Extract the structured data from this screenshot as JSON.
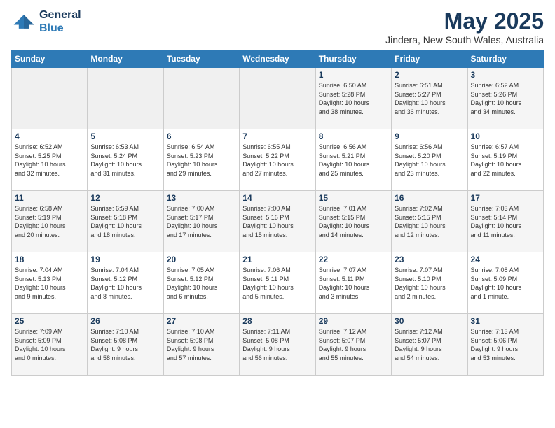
{
  "header": {
    "logo_line1": "General",
    "logo_line2": "Blue",
    "month": "May 2025",
    "location": "Jindera, New South Wales, Australia"
  },
  "days_of_week": [
    "Sunday",
    "Monday",
    "Tuesday",
    "Wednesday",
    "Thursday",
    "Friday",
    "Saturday"
  ],
  "weeks": [
    [
      {
        "day": "",
        "info": ""
      },
      {
        "day": "",
        "info": ""
      },
      {
        "day": "",
        "info": ""
      },
      {
        "day": "",
        "info": ""
      },
      {
        "day": "1",
        "info": "Sunrise: 6:50 AM\nSunset: 5:28 PM\nDaylight: 10 hours\nand 38 minutes."
      },
      {
        "day": "2",
        "info": "Sunrise: 6:51 AM\nSunset: 5:27 PM\nDaylight: 10 hours\nand 36 minutes."
      },
      {
        "day": "3",
        "info": "Sunrise: 6:52 AM\nSunset: 5:26 PM\nDaylight: 10 hours\nand 34 minutes."
      }
    ],
    [
      {
        "day": "4",
        "info": "Sunrise: 6:52 AM\nSunset: 5:25 PM\nDaylight: 10 hours\nand 32 minutes."
      },
      {
        "day": "5",
        "info": "Sunrise: 6:53 AM\nSunset: 5:24 PM\nDaylight: 10 hours\nand 31 minutes."
      },
      {
        "day": "6",
        "info": "Sunrise: 6:54 AM\nSunset: 5:23 PM\nDaylight: 10 hours\nand 29 minutes."
      },
      {
        "day": "7",
        "info": "Sunrise: 6:55 AM\nSunset: 5:22 PM\nDaylight: 10 hours\nand 27 minutes."
      },
      {
        "day": "8",
        "info": "Sunrise: 6:56 AM\nSunset: 5:21 PM\nDaylight: 10 hours\nand 25 minutes."
      },
      {
        "day": "9",
        "info": "Sunrise: 6:56 AM\nSunset: 5:20 PM\nDaylight: 10 hours\nand 23 minutes."
      },
      {
        "day": "10",
        "info": "Sunrise: 6:57 AM\nSunset: 5:19 PM\nDaylight: 10 hours\nand 22 minutes."
      }
    ],
    [
      {
        "day": "11",
        "info": "Sunrise: 6:58 AM\nSunset: 5:19 PM\nDaylight: 10 hours\nand 20 minutes."
      },
      {
        "day": "12",
        "info": "Sunrise: 6:59 AM\nSunset: 5:18 PM\nDaylight: 10 hours\nand 18 minutes."
      },
      {
        "day": "13",
        "info": "Sunrise: 7:00 AM\nSunset: 5:17 PM\nDaylight: 10 hours\nand 17 minutes."
      },
      {
        "day": "14",
        "info": "Sunrise: 7:00 AM\nSunset: 5:16 PM\nDaylight: 10 hours\nand 15 minutes."
      },
      {
        "day": "15",
        "info": "Sunrise: 7:01 AM\nSunset: 5:15 PM\nDaylight: 10 hours\nand 14 minutes."
      },
      {
        "day": "16",
        "info": "Sunrise: 7:02 AM\nSunset: 5:15 PM\nDaylight: 10 hours\nand 12 minutes."
      },
      {
        "day": "17",
        "info": "Sunrise: 7:03 AM\nSunset: 5:14 PM\nDaylight: 10 hours\nand 11 minutes."
      }
    ],
    [
      {
        "day": "18",
        "info": "Sunrise: 7:04 AM\nSunset: 5:13 PM\nDaylight: 10 hours\nand 9 minutes."
      },
      {
        "day": "19",
        "info": "Sunrise: 7:04 AM\nSunset: 5:12 PM\nDaylight: 10 hours\nand 8 minutes."
      },
      {
        "day": "20",
        "info": "Sunrise: 7:05 AM\nSunset: 5:12 PM\nDaylight: 10 hours\nand 6 minutes."
      },
      {
        "day": "21",
        "info": "Sunrise: 7:06 AM\nSunset: 5:11 PM\nDaylight: 10 hours\nand 5 minutes."
      },
      {
        "day": "22",
        "info": "Sunrise: 7:07 AM\nSunset: 5:11 PM\nDaylight: 10 hours\nand 3 minutes."
      },
      {
        "day": "23",
        "info": "Sunrise: 7:07 AM\nSunset: 5:10 PM\nDaylight: 10 hours\nand 2 minutes."
      },
      {
        "day": "24",
        "info": "Sunrise: 7:08 AM\nSunset: 5:09 PM\nDaylight: 10 hours\nand 1 minute."
      }
    ],
    [
      {
        "day": "25",
        "info": "Sunrise: 7:09 AM\nSunset: 5:09 PM\nDaylight: 10 hours\nand 0 minutes."
      },
      {
        "day": "26",
        "info": "Sunrise: 7:10 AM\nSunset: 5:08 PM\nDaylight: 9 hours\nand 58 minutes."
      },
      {
        "day": "27",
        "info": "Sunrise: 7:10 AM\nSunset: 5:08 PM\nDaylight: 9 hours\nand 57 minutes."
      },
      {
        "day": "28",
        "info": "Sunrise: 7:11 AM\nSunset: 5:08 PM\nDaylight: 9 hours\nand 56 minutes."
      },
      {
        "day": "29",
        "info": "Sunrise: 7:12 AM\nSunset: 5:07 PM\nDaylight: 9 hours\nand 55 minutes."
      },
      {
        "day": "30",
        "info": "Sunrise: 7:12 AM\nSunset: 5:07 PM\nDaylight: 9 hours\nand 54 minutes."
      },
      {
        "day": "31",
        "info": "Sunrise: 7:13 AM\nSunset: 5:06 PM\nDaylight: 9 hours\nand 53 minutes."
      }
    ]
  ]
}
